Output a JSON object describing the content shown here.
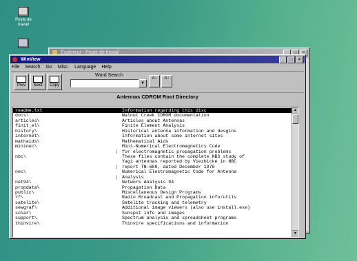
{
  "desktop": {
    "icons": [
      {
        "label": "Poste de travail",
        "icon": "computer-icon"
      },
      {
        "label": "",
        "icon": "network-icon"
      }
    ]
  },
  "back_window": {
    "title": "Exploreur - Poste de travail",
    "buttons": [
      "_",
      "□",
      "×"
    ]
  },
  "window": {
    "title": "WinView",
    "buttons": [
      "_",
      "□",
      "×"
    ]
  },
  "menu": [
    "File",
    "Search",
    "Go",
    "Misc.",
    "Language",
    "Help"
  ],
  "toolbar": {
    "prev_label": "Prev",
    "select_label": "Selct",
    "copy_label": "Copy",
    "word_search_label": "Word Search",
    "word_search_value": "",
    "find_label": "A↓",
    "find_all_label": "A↑"
  },
  "directory": {
    "header": "Antennas CDROM Root Directory",
    "rows": [
      {
        "name": "readme.txt",
        "desc": "Information regarding this disc",
        "selected": true,
        "mark": ""
      },
      {
        "name": "docs\\",
        "desc": "Walnut Creek CDROM documentation",
        "selected": false,
        "mark": ""
      },
      {
        "name": "articles\\",
        "desc": "Articles about Antennas",
        "selected": false,
        "mark": ""
      },
      {
        "name": "finit_el\\",
        "desc": "Finite Element Analysis",
        "selected": false,
        "mark": ""
      },
      {
        "name": "history\\",
        "desc": "Historical antenna information and desgins",
        "selected": false,
        "mark": ""
      },
      {
        "name": "internet\\",
        "desc": "Information about some internet sites",
        "selected": false,
        "mark": ""
      },
      {
        "name": "mathaids\\",
        "desc": "Mathematical Aids",
        "selected": false,
        "mark": ""
      },
      {
        "name": "mininec\\",
        "desc": "Mini-Numerical Electromagnetics Code",
        "selected": false,
        "mark": ""
      },
      {
        "name": "",
        "desc": "for electromagnetic propagation problems",
        "selected": false,
        "mark": "|"
      },
      {
        "name": "nbc\\",
        "desc": "These files contain the complete NBS study of",
        "selected": false,
        "mark": ""
      },
      {
        "name": "",
        "desc": "Yagi antennas reported by Viezbicke in NBC",
        "selected": false,
        "mark": ""
      },
      {
        "name": "",
        "desc": "report TN-688, dated December 1976",
        "selected": false,
        "mark": "|"
      },
      {
        "name": "nec\\",
        "desc": "Numerical Electromagnetic Code for Antenna",
        "selected": false,
        "mark": ""
      },
      {
        "name": "",
        "desc": "Analysis",
        "selected": false,
        "mark": "|"
      },
      {
        "name": "net94\\",
        "desc": "Network Analysis 94",
        "selected": false,
        "mark": ""
      },
      {
        "name": "propdata\\",
        "desc": "Propagation Data",
        "selected": false,
        "mark": ""
      },
      {
        "name": "public\\",
        "desc": "Miscellaneous Design Programs",
        "selected": false,
        "mark": ""
      },
      {
        "name": "rf\\",
        "desc": "Radio Broadcast and Propagation info/utils",
        "selected": false,
        "mark": ""
      },
      {
        "name": "satelite\\",
        "desc": "Satelite tracking and telemetry",
        "selected": false,
        "mark": ""
      },
      {
        "name": "sewgraf\\",
        "desc": "Additional image viewers (also use install.exe)",
        "selected": false,
        "mark": ""
      },
      {
        "name": "solar\\",
        "desc": "Sunspot info and images",
        "selected": false,
        "mark": ""
      },
      {
        "name": "support\\",
        "desc": "Spectrum analysis and spreadsheet programs",
        "selected": false,
        "mark": ""
      },
      {
        "name": "thinvire\\",
        "desc": "Thinvire specifications and information",
        "selected": false,
        "mark": ""
      }
    ]
  }
}
